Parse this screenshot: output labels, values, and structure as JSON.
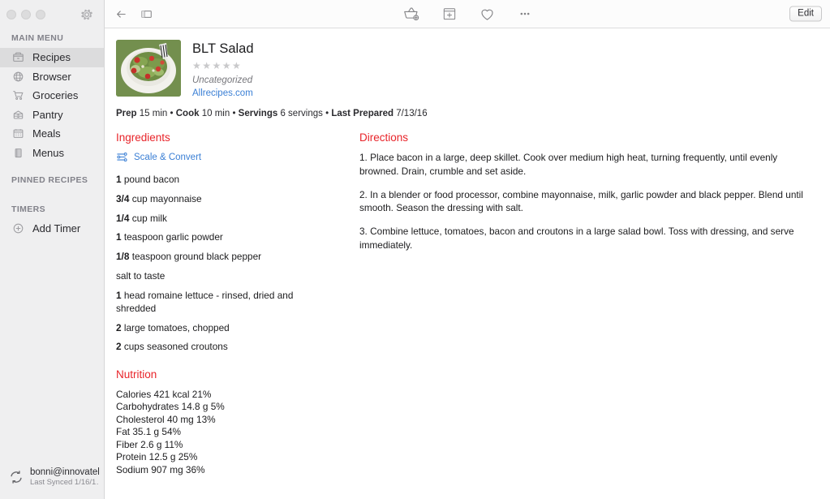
{
  "window": {
    "traffic_lights": [
      "close",
      "minimize",
      "zoom"
    ],
    "settings_icon": "gear-icon"
  },
  "sidebar": {
    "sections": [
      {
        "label": "MAIN MENU",
        "items": [
          {
            "label": "Recipes",
            "icon": "recipe-box-icon",
            "selected": true
          },
          {
            "label": "Browser",
            "icon": "globe-icon",
            "selected": false
          },
          {
            "label": "Groceries",
            "icon": "shopping-cart-icon",
            "selected": false
          },
          {
            "label": "Pantry",
            "icon": "pantry-drawer-icon",
            "selected": false
          },
          {
            "label": "Meals",
            "icon": "calendar-icon",
            "selected": false
          },
          {
            "label": "Menus",
            "icon": "menu-book-icon",
            "selected": false
          }
        ]
      },
      {
        "label": "PINNED RECIPES",
        "items": []
      },
      {
        "label": "TIMERS",
        "items": [
          {
            "label": "Add Timer",
            "icon": "plus-circle-icon",
            "selected": false
          }
        ]
      }
    ],
    "account": {
      "name": "bonni@innovatel…",
      "sync_status": "Last Synced 1/16/1…",
      "icon": "sync-icon"
    }
  },
  "toolbar": {
    "back_icon": "back-arrow-icon",
    "sidebar_toggle_icon": "sidebar-toggle-icon",
    "center_actions": [
      {
        "name": "add-to-groceries",
        "icon": "basket-plus-icon"
      },
      {
        "name": "add-to-meals",
        "icon": "square-plus-icon"
      },
      {
        "name": "favorite",
        "icon": "heart-icon"
      },
      {
        "name": "more-options",
        "icon": "ellipsis-icon"
      }
    ],
    "edit_label": "Edit"
  },
  "recipe": {
    "title": "BLT Salad",
    "rating": 0,
    "rating_max": 5,
    "category": "Uncategorized",
    "source": "Allrecipes.com",
    "thumbnail_alt": "blt-salad-photo",
    "meta": {
      "prep_label": "Prep",
      "prep_value": "15 min",
      "cook_label": "Cook",
      "cook_value": "10 min",
      "servings_label": "Servings",
      "servings_value": "6 servings",
      "last_prepared_label": "Last Prepared",
      "last_prepared_value": "7/13/16",
      "separator": "•"
    },
    "ingredients_title": "Ingredients",
    "scale_convert_label": "Scale & Convert",
    "ingredients": [
      {
        "qty": "1",
        "text": "pound bacon"
      },
      {
        "qty": "3/4",
        "text": "cup mayonnaise"
      },
      {
        "qty": "1/4",
        "text": "cup milk"
      },
      {
        "qty": "1",
        "text": "teaspoon garlic powder"
      },
      {
        "qty": "1/8",
        "text": "teaspoon ground black pepper"
      },
      {
        "qty": "",
        "text": "salt to taste"
      },
      {
        "qty": "1",
        "text": "head romaine lettuce - rinsed, dried and shredded"
      },
      {
        "qty": "2",
        "text": "large tomatoes, chopped"
      },
      {
        "qty": "2",
        "text": "cups seasoned croutons"
      }
    ],
    "nutrition_title": "Nutrition",
    "nutrition": [
      "Calories 421 kcal 21%",
      "Carbohydrates 14.8 g 5%",
      "Cholesterol 40 mg 13%",
      "Fat 35.1 g 54%",
      "Fiber 2.6 g 11%",
      "Protein 12.5 g 25%",
      "Sodium 907 mg 36%"
    ],
    "directions_title": "Directions",
    "directions": [
      "1. Place bacon in a large, deep skillet. Cook over medium high heat, turning frequently, until evenly browned. Drain, crumble and set aside.",
      "2. In a blender or food processor, combine mayonnaise, milk, garlic powder and black pepper. Blend until smooth. Season the dressing with salt.",
      "3. Combine lettuce, tomatoes, bacon and croutons in a large salad bowl. Toss with dressing, and serve immediately."
    ]
  },
  "colors": {
    "accent_red": "#e8242a",
    "link_blue": "#3a7fd5",
    "sidebar_bg": "#efeff0",
    "selected_bg": "#dcdcdd"
  }
}
